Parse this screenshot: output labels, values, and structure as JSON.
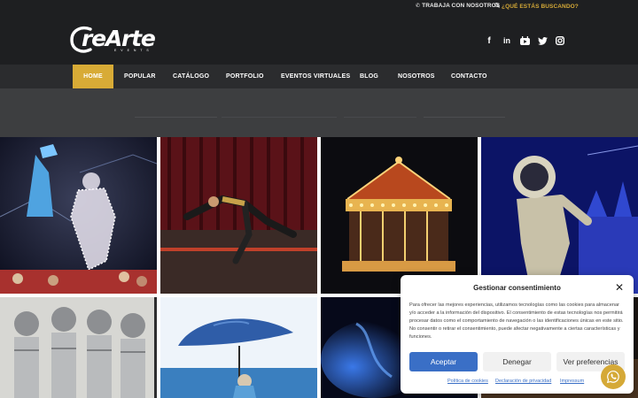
{
  "topbar": {
    "work_label": "TRABAJA CON NOSOTROS",
    "search_label": "¿QUÉ ESTÁS BUSCANDO?"
  },
  "brand": {
    "logo_text": "reArte",
    "logo_sub": "E V E N T S",
    "accent": "#d8ab36"
  },
  "social": {
    "facebook": "f",
    "linkedin": "in",
    "youtube": "▶",
    "twitter": "t",
    "instagram": "◎"
  },
  "nav": {
    "items": [
      {
        "label": "HOME"
      },
      {
        "label": "POPULAR"
      },
      {
        "label": "CATÁLOGO"
      },
      {
        "label": "PORTFOLIO"
      },
      {
        "label": "EVENTOS VIRTUALES"
      },
      {
        "label": "BLOG"
      },
      {
        "label": "NOSOTROS"
      },
      {
        "label": "CONTACTO"
      }
    ]
  },
  "consent": {
    "title": "Gestionar consentimiento",
    "close": "✕",
    "body": "Para ofrecer las mejores experiencias, utilizamos tecnologías como las cookies para almacenar y/o acceder a la información del dispositivo. El consentimiento de estas tecnologías nos permitirá procesar datos como el comportamiento de navegación o las identificaciones únicas en este sitio. No consentir o retirar el consentimiento, puede afectar negativamente a ciertas características y funciones.",
    "accept": "Aceptar",
    "deny": "Denegar",
    "prefs": "Ver preferencias",
    "links": [
      "Política de cookies",
      "Declaración de privacidad",
      "Impressum"
    ],
    "accept_color": "#3a6fc6"
  }
}
